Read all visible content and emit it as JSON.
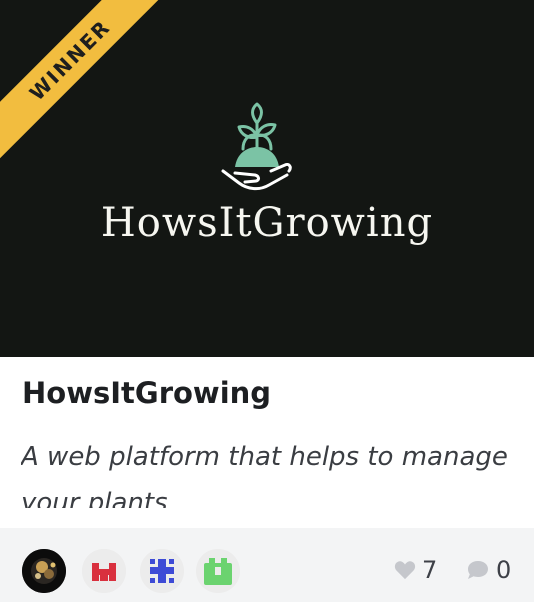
{
  "badge": {
    "label": "WINNER",
    "color": "#f2bd3f"
  },
  "project": {
    "logo_text": "HowsItGrowing",
    "title": "HowsItGrowing",
    "tagline": "A web platform that helps to manage your plants"
  },
  "icons": {
    "logo": "seedling-in-hand-icon",
    "like": "heart-icon",
    "comment": "speech-bubble-icon"
  },
  "team": [
    {
      "name": "team-member-avatar-1",
      "icon": "photo-avatar"
    },
    {
      "name": "team-member-avatar-2",
      "icon": "red-identicon"
    },
    {
      "name": "team-member-avatar-3",
      "icon": "blue-identicon"
    },
    {
      "name": "team-member-avatar-4",
      "icon": "green-identicon"
    }
  ],
  "stats": {
    "likes": "7",
    "comments": "0"
  }
}
